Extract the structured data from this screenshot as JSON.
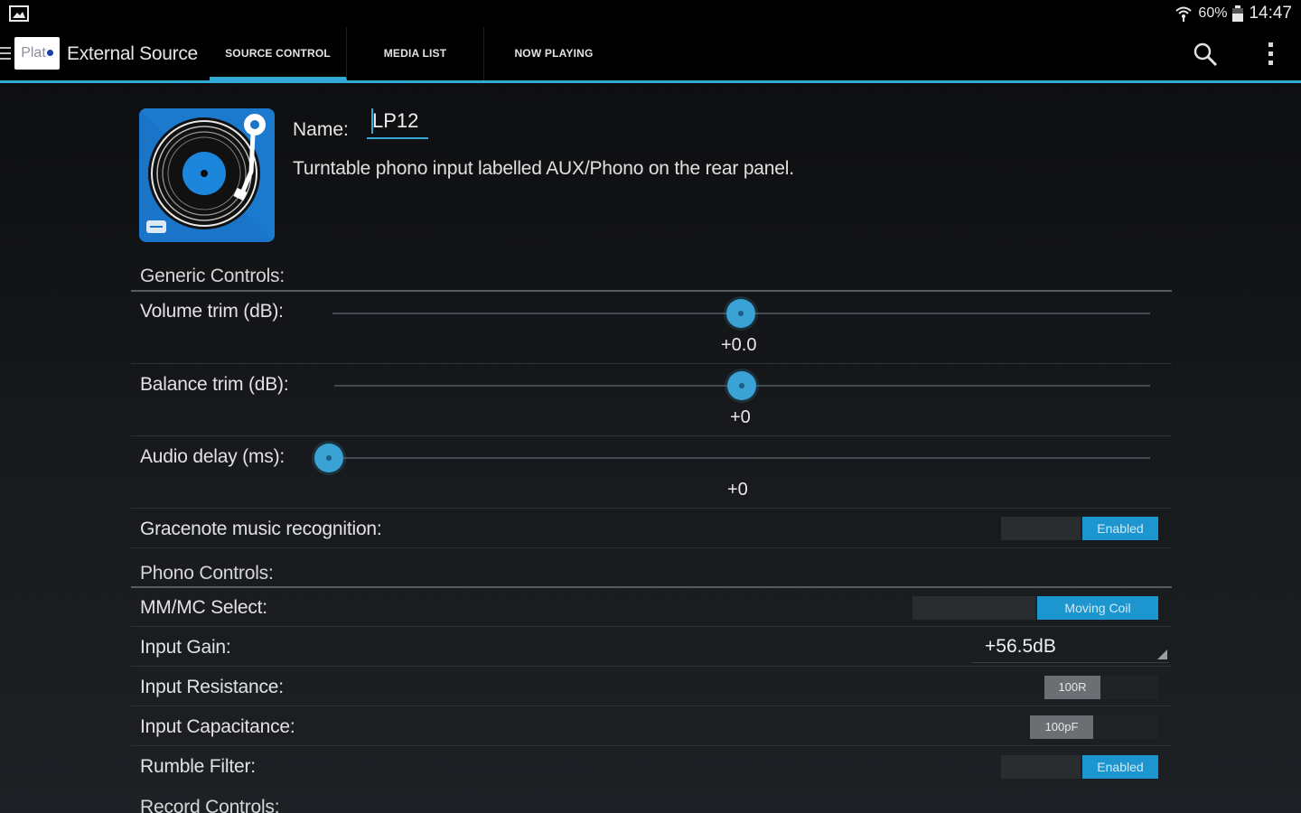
{
  "status_bar": {
    "battery_percent": "60%",
    "time": "14:47"
  },
  "app_bar": {
    "logo_text": "Plat",
    "title": "External Source",
    "tabs": [
      {
        "label": "SOURCE CONTROL",
        "active": true
      },
      {
        "label": "MEDIA LIST",
        "active": false
      },
      {
        "label": "NOW PLAYING",
        "active": false
      }
    ],
    "accent_color": "#33a9d8"
  },
  "source": {
    "name_label": "Name:",
    "name_value": "LP12",
    "description": "Turntable phono input labelled AUX/Phono on the rear panel."
  },
  "generic_controls": {
    "header": "Generic Controls:",
    "volume_trim": {
      "label": "Volume trim (dB):",
      "value": "+0.0",
      "position": 0.5
    },
    "balance_trim": {
      "label": "Balance trim (dB):",
      "value": "+0",
      "position": 0.5
    },
    "audio_delay": {
      "label": "Audio delay (ms):",
      "value": "+0",
      "position": 0.0
    },
    "gracenote": {
      "label": "Gracenote music recognition:",
      "state": "Enabled"
    }
  },
  "phono_controls": {
    "header": "Phono Controls:",
    "mm_mc": {
      "label": "MM/MC Select:",
      "state": "Moving Coil"
    },
    "input_gain": {
      "label": "Input Gain:",
      "value": "+56.5dB"
    },
    "input_resistance": {
      "label": "Input Resistance:",
      "value": "100R"
    },
    "input_capacitance": {
      "label": "Input Capacitance:",
      "value": "100pF"
    },
    "rumble_filter": {
      "label": "Rumble Filter:",
      "state": "Enabled"
    }
  },
  "record_controls": {
    "header": "Record Controls:"
  }
}
